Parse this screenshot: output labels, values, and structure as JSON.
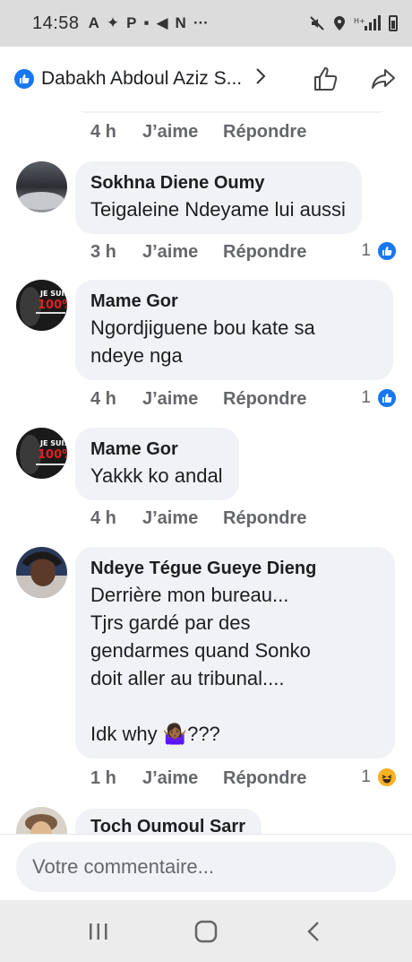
{
  "status_bar": {
    "time": "14:58",
    "left_icons": [
      "A",
      "✦",
      "P",
      "▪",
      "◀",
      "N",
      "···"
    ],
    "right_icons": [
      "mute-icon",
      "location-icon",
      "signal-icon",
      "battery-icon"
    ]
  },
  "header": {
    "title": "Dabakh Abdoul Aziz S...",
    "accent": "#1877f2"
  },
  "top_comment_meta": {
    "time": "4 h",
    "like_label": "J’aime",
    "reply_label": "Répondre"
  },
  "comments": [
    {
      "author": "Sokhna Diene Oumy",
      "text": "Teigaleine Ndeyame lui aussi",
      "time": "3 h",
      "like_label": "J’aime",
      "reply_label": "Répondre",
      "reaction_count": "1",
      "reaction": "like-icon"
    },
    {
      "author": "Mame Gor",
      "text": "Ngordjiguene bou kate sa\nndeye nga",
      "time": "4 h",
      "like_label": "J’aime",
      "reply_label": "Répondre",
      "reaction_count": "1",
      "reaction": "like-icon",
      "avatar_text": [
        "JE SUIS",
        "100%"
      ]
    },
    {
      "author": "Mame Gor",
      "text": "Yakkk ko andal",
      "time": "4 h",
      "like_label": "J’aime",
      "reply_label": "Répondre",
      "avatar_text": [
        "JE SUIS",
        "100%"
      ]
    },
    {
      "author": "Ndeye Tégue Gueye Dieng",
      "text": "Derrière mon bureau...\nTjrs gardé par des\ngendarmes quand Sonko\ndoit aller au tribunal....\n\nIdk why 🤷🏾‍♀️???",
      "time": "1 h",
      "like_label": "J’aime",
      "reply_label": "Répondre",
      "reaction_count": "1",
      "reaction": "haha-icon"
    },
    {
      "author": "Toch Oumoul Sarr"
    }
  ],
  "input": {
    "placeholder": "Votre commentaire..."
  }
}
